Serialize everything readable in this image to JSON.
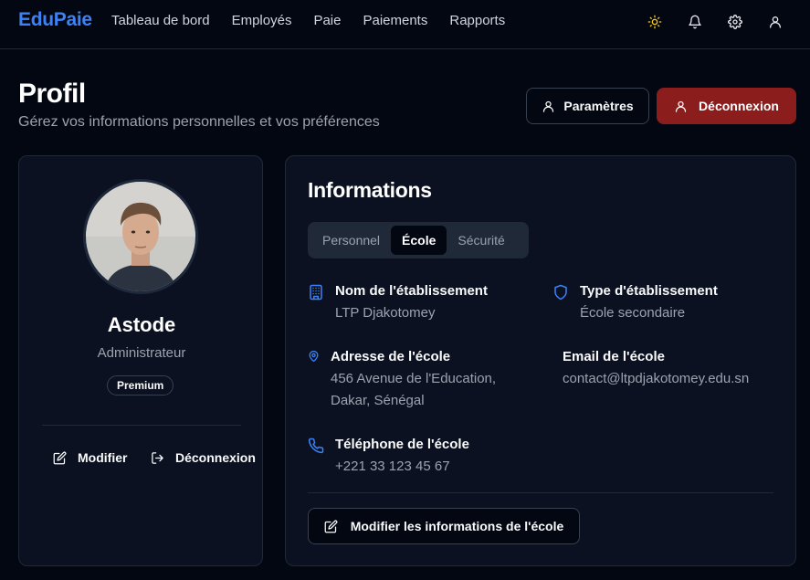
{
  "nav": {
    "brand": "EduPaie",
    "links": [
      "Tableau de bord",
      "Employés",
      "Paie",
      "Paiements",
      "Rapports"
    ],
    "icons": [
      "sun-icon",
      "bell-icon",
      "gear-icon",
      "user-icon"
    ]
  },
  "header": {
    "title": "Profil",
    "subtitle": "Gérez vos informations personnelles et vos préférences",
    "settings_label": "Paramètres",
    "logout_label": "Déconnexion"
  },
  "profile": {
    "name": "Astode",
    "role": "Administrateur",
    "badge": "Premium",
    "edit_label": "Modifier",
    "logout_label": "Déconnexion"
  },
  "info": {
    "title": "Informations",
    "tabs": [
      "Personnel",
      "École",
      "Sécurité"
    ],
    "active_tab": "École",
    "fields": {
      "name": {
        "label": "Nom de l'établissement",
        "value": "LTP Djakotomey"
      },
      "type": {
        "label": "Type d'établissement",
        "value": "École secondaire"
      },
      "address": {
        "label": "Adresse de l'école",
        "line1": "456 Avenue de l'Education,",
        "line2": "Dakar, Sénégal"
      },
      "email": {
        "label": "Email de l'école",
        "value": "contact@ltpdjakotomey.edu.sn"
      },
      "phone": {
        "label": "Téléphone de l'école",
        "value": "+221 33 123 45 67"
      }
    },
    "edit_button": "Modifier les informations de l'école"
  },
  "colors": {
    "background": "#030712",
    "brand": "#3b82f6",
    "danger": "#8b1d1d",
    "accent_icon": "#3b82f6",
    "sun": "#facc15"
  }
}
